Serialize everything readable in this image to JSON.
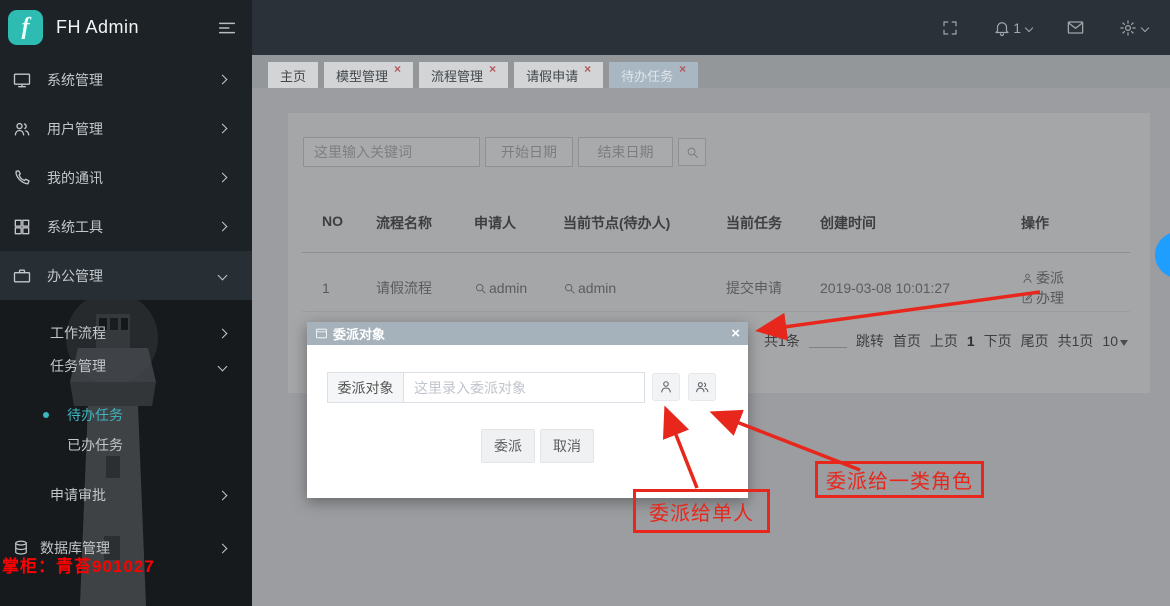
{
  "app": {
    "title": "FH Admin",
    "logo_letter": "f"
  },
  "topbar": {
    "notification_badge": "1"
  },
  "sidebar": {
    "items": [
      {
        "label": "系统管理"
      },
      {
        "label": "用户管理"
      },
      {
        "label": "我的通讯"
      },
      {
        "label": "系统工具"
      },
      {
        "label": "办公管理"
      }
    ],
    "office_sub": [
      {
        "label": "工作流程"
      },
      {
        "label": "任务管理"
      }
    ],
    "task_sub": [
      {
        "label": "待办任务"
      },
      {
        "label": "已办任务"
      }
    ],
    "approve_label": "申请审批",
    "db_label": "数据库管理"
  },
  "tabs": [
    {
      "label": "主页"
    },
    {
      "label": "模型管理",
      "close": "×"
    },
    {
      "label": "流程管理",
      "close": "×"
    },
    {
      "label": "请假申请",
      "close": "×"
    },
    {
      "label": "待办任务",
      "close": "×"
    }
  ],
  "filters": {
    "keyword_placeholder": "这里输入关键词",
    "start_date": "开始日期",
    "end_date": "结束日期"
  },
  "table": {
    "headers": [
      "NO",
      "流程名称",
      "申请人",
      "当前节点(待办人)",
      "当前任务",
      "创建时间",
      "操作"
    ],
    "row": {
      "no": "1",
      "process": "请假流程",
      "applicant": "admin",
      "node": "admin",
      "task": "提交申请",
      "created": "2019-03-08 10:01:27",
      "action_delegate": "委派",
      "action_handle": "办理"
    }
  },
  "pagination": {
    "total": "共1条",
    "jump": "跳转",
    "first": "首页",
    "prev": "上页",
    "current": "1",
    "next": "下页",
    "last": "尾页",
    "pages": "共1页",
    "size": "10"
  },
  "modal": {
    "title": "委派对象",
    "close": "×",
    "field_label": "委派对象",
    "placeholder": "这里录入委派对象",
    "confirm": "委派",
    "cancel": "取消"
  },
  "annotations": {
    "single_person": "委派给单人",
    "role_group": "委派给一类角色",
    "watermark": "掌柜：青苔901027"
  },
  "colors": {
    "logo_teal": "#2ebcb2",
    "active_menu_cyan": "#3eb5c0",
    "annotation_red": "#e8271c",
    "floating_button_blue": "#1e9fff",
    "modal_header": "#a5b2bc",
    "active_tab": "#a9b7c3"
  }
}
